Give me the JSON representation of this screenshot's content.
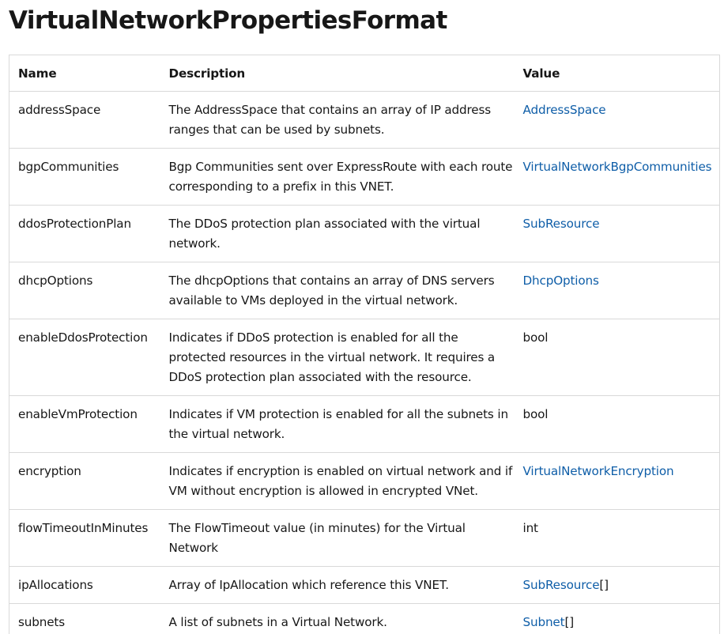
{
  "page": {
    "title": "VirtualNetworkPropertiesFormat"
  },
  "table": {
    "headers": [
      "Name",
      "Description",
      "Value"
    ],
    "rows": [
      {
        "name": "addressSpace",
        "description": "The AddressSpace that contains an array of IP address ranges that can be used by subnets.",
        "value": "AddressSpace",
        "suffix": "",
        "is_link": true
      },
      {
        "name": "bgpCommunities",
        "description": "Bgp Communities sent over ExpressRoute with each route corresponding to a prefix in this VNET.",
        "value": "VirtualNetworkBgpCommunities",
        "suffix": "",
        "is_link": true
      },
      {
        "name": "ddosProtectionPlan",
        "description": "The DDoS protection plan associated with the virtual network.",
        "value": "SubResource",
        "suffix": "",
        "is_link": true
      },
      {
        "name": "dhcpOptions",
        "description": "The dhcpOptions that contains an array of DNS servers available to VMs deployed in the virtual network.",
        "value": "DhcpOptions",
        "suffix": "",
        "is_link": true
      },
      {
        "name": "enableDdosProtection",
        "description": "Indicates if DDoS protection is enabled for all the protected resources in the virtual network. It requires a DDoS protection plan associated with the resource.",
        "value": "bool",
        "suffix": "",
        "is_link": false
      },
      {
        "name": "enableVmProtection",
        "description": "Indicates if VM protection is enabled for all the subnets in the virtual network.",
        "value": "bool",
        "suffix": "",
        "is_link": false
      },
      {
        "name": "encryption",
        "description": "Indicates if encryption is enabled on virtual network and if VM without encryption is allowed in encrypted VNet.",
        "value": "VirtualNetworkEncryption",
        "suffix": "",
        "is_link": true
      },
      {
        "name": "flowTimeoutInMinutes",
        "description": "The FlowTimeout value (in minutes) for the Virtual Network",
        "value": "int",
        "suffix": "",
        "is_link": false
      },
      {
        "name": "ipAllocations",
        "description": "Array of IpAllocation which reference this VNET.",
        "value": "SubResource",
        "suffix": "[]",
        "is_link": true
      },
      {
        "name": "subnets",
        "description": "A list of subnets in a Virtual Network.",
        "value": "Subnet",
        "suffix": "[]",
        "is_link": true
      }
    ]
  },
  "colors": {
    "link": "#0f5ea8",
    "text": "#171717",
    "border": "#d9d9d9"
  }
}
